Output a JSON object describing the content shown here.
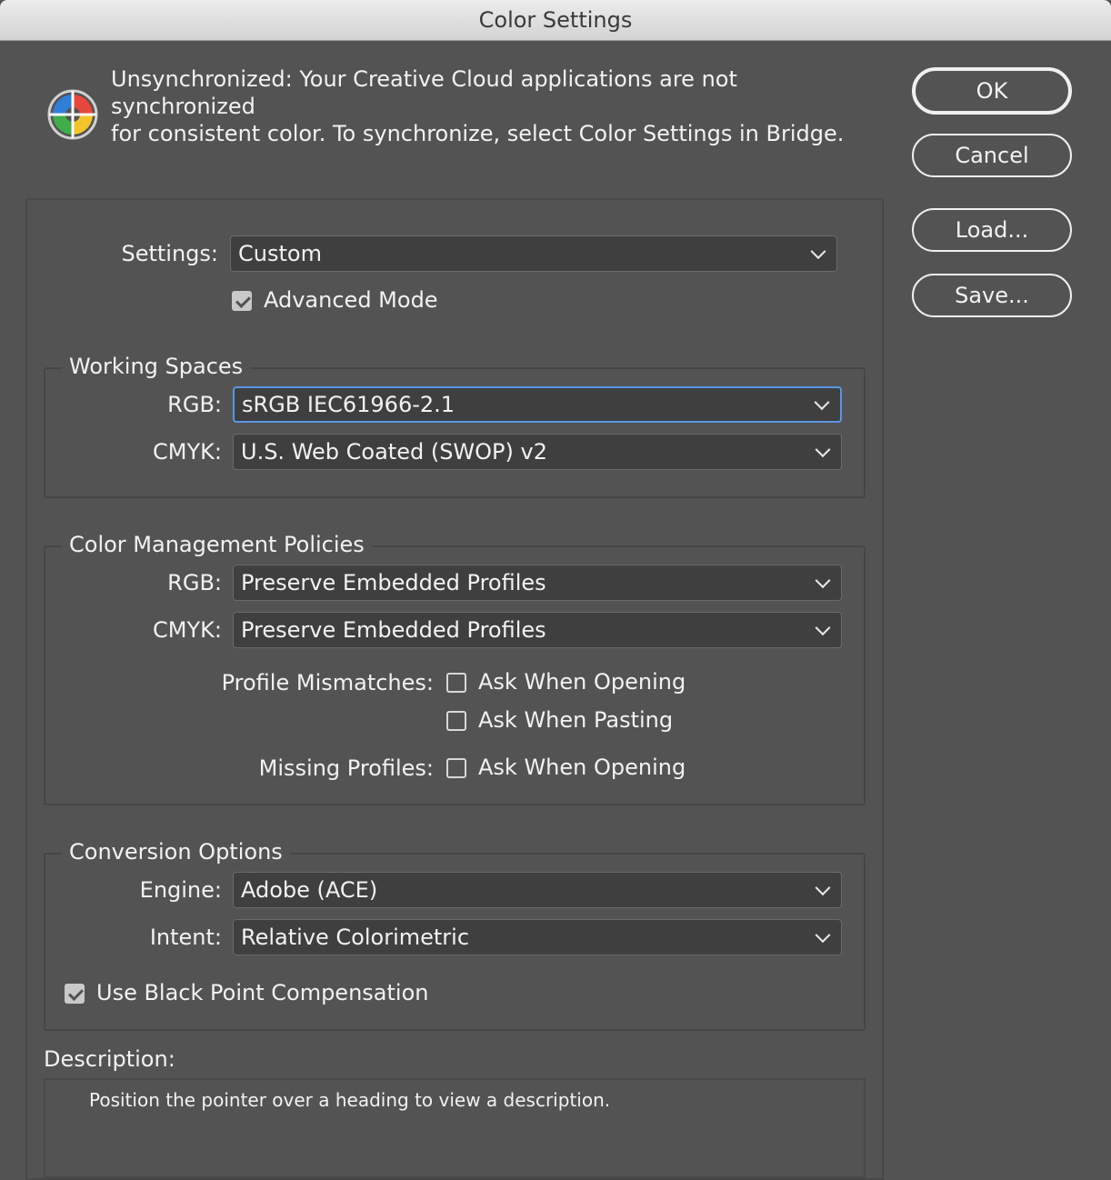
{
  "window": {
    "title": "Color Settings"
  },
  "sync": {
    "icon": "color-settings-sync-icon",
    "line1": "Unsynchronized: Your Creative Cloud applications are not synchronized",
    "line2": "for consistent color. To synchronize, select Color Settings in Bridge."
  },
  "buttons": {
    "ok": "OK",
    "cancel": "Cancel",
    "load": "Load...",
    "save": "Save..."
  },
  "settings": {
    "label": "Settings:",
    "value": "Custom",
    "advanced_mode_label": "Advanced Mode",
    "advanced_mode_checked": true
  },
  "working_spaces": {
    "title": "Working Spaces",
    "rgb_label": "RGB:",
    "rgb_value": "sRGB IEC61966-2.1",
    "cmyk_label": "CMYK:",
    "cmyk_value": "U.S. Web Coated (SWOP) v2"
  },
  "policies": {
    "title": "Color Management Policies",
    "rgb_label": "RGB:",
    "rgb_value": "Preserve Embedded Profiles",
    "cmyk_label": "CMYK:",
    "cmyk_value": "Preserve Embedded Profiles",
    "profile_mismatches_label": "Profile Mismatches:",
    "mismatch_open_label": "Ask When Opening",
    "mismatch_open_checked": false,
    "mismatch_paste_label": "Ask When Pasting",
    "mismatch_paste_checked": false,
    "missing_profiles_label": "Missing Profiles:",
    "missing_open_label": "Ask When Opening",
    "missing_open_checked": false
  },
  "conversion": {
    "title": "Conversion Options",
    "engine_label": "Engine:",
    "engine_value": "Adobe (ACE)",
    "intent_label": "Intent:",
    "intent_value": "Relative Colorimetric",
    "bpc_label": "Use Black Point Compensation",
    "bpc_checked": true
  },
  "description": {
    "label": "Description:",
    "text": "Position the pointer over a heading to view a description."
  },
  "colors": {
    "accent_focus": "#5a96e6",
    "background": "#535353"
  }
}
